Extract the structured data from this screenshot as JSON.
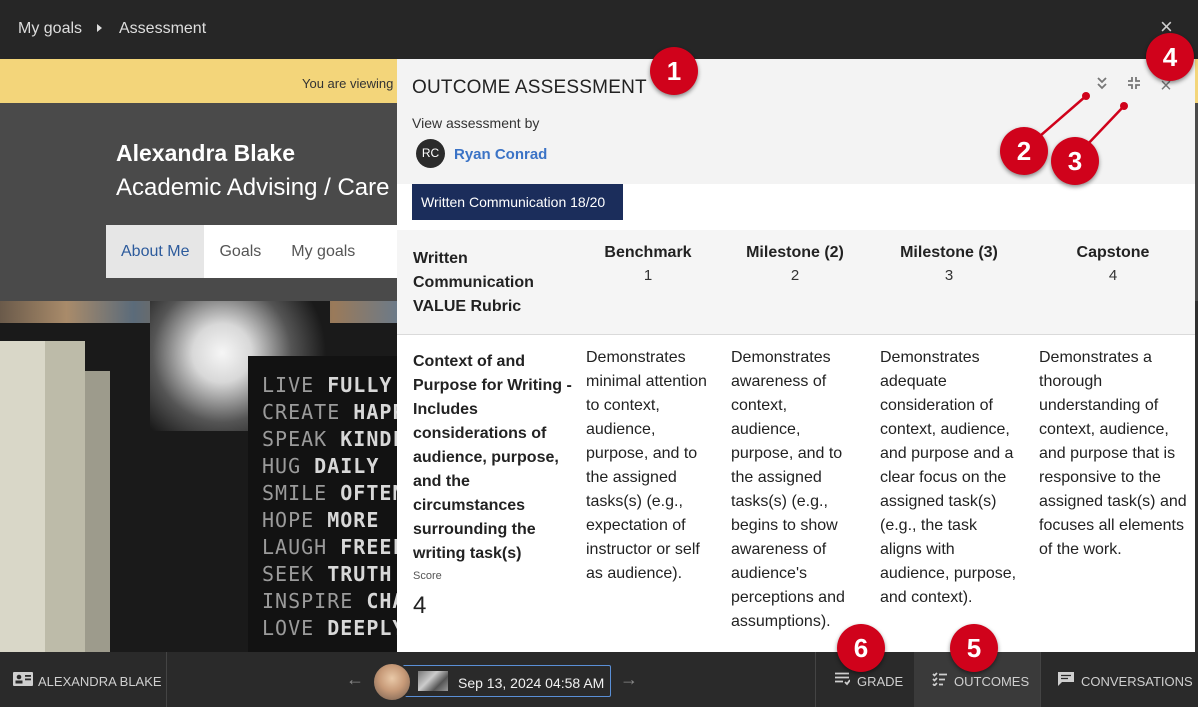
{
  "topbar": {
    "crumbs": [
      "My goals",
      "Assessment"
    ],
    "close_glyph": "×"
  },
  "banner": {
    "text": "You are viewing"
  },
  "profile": {
    "name": "Alexandra Blake",
    "title": "Academic Advising / Care",
    "tabs": [
      "About Me",
      "Goals",
      "My goals"
    ]
  },
  "photo_quote": [
    {
      "a": "LIVE",
      "b": "FULLY"
    },
    {
      "a": "CREATE",
      "b": "HAPPI"
    },
    {
      "a": "SPEAK",
      "b": "KINDLY"
    },
    {
      "a": "HUG",
      "b": "DAILY"
    },
    {
      "a": "SMILE",
      "b": "OFTEN"
    },
    {
      "a": "HOPE",
      "b": "MORE"
    },
    {
      "a": "LAUGH",
      "b": "FREELY"
    },
    {
      "a": "SEEK",
      "b": "TRUTH"
    },
    {
      "a": "INSPIRE",
      "b": "CHAN"
    },
    {
      "a": "LOVE",
      "b": "DEEPLY"
    }
  ],
  "panel": {
    "title": "OUTCOME ASSESSMENT",
    "view_by_label": "View assessment by",
    "assessor_initials": "RC",
    "assessor_name": "Ryan Conrad",
    "buttons": {
      "collapse_glyph": "⌄",
      "minimize_glyph": "⤡",
      "close_glyph": "×"
    },
    "outcome_chip": "Written Communication 18/20",
    "rubric": {
      "title": "Written Communication VALUE Rubric",
      "levels": [
        {
          "name": "Benchmark",
          "num": "1"
        },
        {
          "name": "Milestone (2)",
          "num": "2"
        },
        {
          "name": "Milestone (3)",
          "num": "3"
        },
        {
          "name": "Capstone",
          "num": "4"
        }
      ],
      "criterion": "Context of and Purpose for Writing - Includes considerations of audience, purpose, and the circumstances surrounding the writing task(s)",
      "score_label": "Score",
      "score_value": "4",
      "descriptions": [
        "Demonstrates minimal attention to context, audience, purpose, and to the assigned tasks(s) (e.g., expectation of instructor or self as audience).",
        "Demonstrates awareness of context, audience, purpose, and to the assigned tasks(s) (e.g., begins to show awareness of audience's perceptions and assumptions).",
        "Demonstrates adequate consideration of context, audience, and purpose and a clear focus on the assigned task(s) (e.g., the task aligns with audience, purpose, and context).",
        "Demonstrates a thorough understanding of context, audience, and purpose that is responsive to the assigned task(s) and focuses all elements of the work."
      ]
    }
  },
  "bottombar": {
    "student_label": "ALEXANDRA BLAKE",
    "prev_glyph": "←",
    "next_glyph": "→",
    "submission_date": "Sep 13, 2024 04:58 AM",
    "tabs": {
      "grade": "GRADE",
      "outcomes": "OUTCOMES",
      "conversations": "CONVERSATIONS"
    }
  },
  "callouts": [
    "1",
    "2",
    "3",
    "4",
    "5",
    "6"
  ],
  "colors": {
    "callout_red": "#d0021b",
    "chip_navy": "#1b2d5b",
    "link_blue": "#3b73c6",
    "banner_yellow": "#f3d57a"
  }
}
